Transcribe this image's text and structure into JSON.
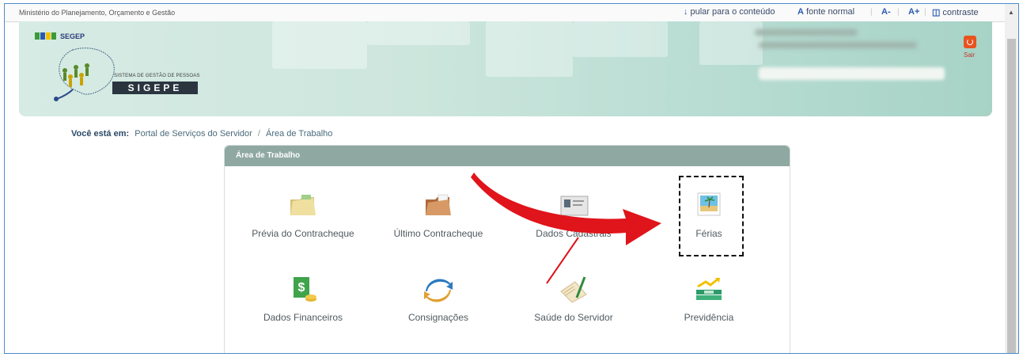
{
  "topbar": {
    "ministry": "Ministério do Planejamento, Orçamento e Gestão",
    "skip_link": "pular para o conteúdo",
    "font_normal": "fonte normal",
    "font_decrease": "A-",
    "font_increase": "A+",
    "contrast": "contraste"
  },
  "header": {
    "org": "SEGEP",
    "system_name": "SISTEMA DE GESTÃO DE PESSOAS",
    "product": "SIGEPE",
    "logout_label": "Sair"
  },
  "breadcrumb": {
    "label": "Você está em:",
    "items": [
      "Portal de Serviços do Servidor",
      "Área de Trabalho"
    ]
  },
  "panel": {
    "title": "Área de Trabalho",
    "tiles": [
      {
        "label": "Prévia do Contracheque",
        "icon": "folder-icon"
      },
      {
        "label": "Último Contracheque",
        "icon": "folder-document-icon"
      },
      {
        "label": "Dados Cadastrais",
        "icon": "id-card-icon"
      },
      {
        "label": "Férias",
        "icon": "beach-photo-icon"
      },
      {
        "label": "Dados Financeiros",
        "icon": "money-icon"
      },
      {
        "label": "Consignações",
        "icon": "refresh-arrows-icon"
      },
      {
        "label": "Saúde do Servidor",
        "icon": "clipboard-pen-icon"
      },
      {
        "label": "Previdência",
        "icon": "money-growth-icon"
      }
    ]
  },
  "colors": {
    "header_bg": "#cde6dd",
    "panel_header": "#8fa8a2",
    "annotation_arrow": "#e0141b",
    "logout": "#e8531f"
  }
}
